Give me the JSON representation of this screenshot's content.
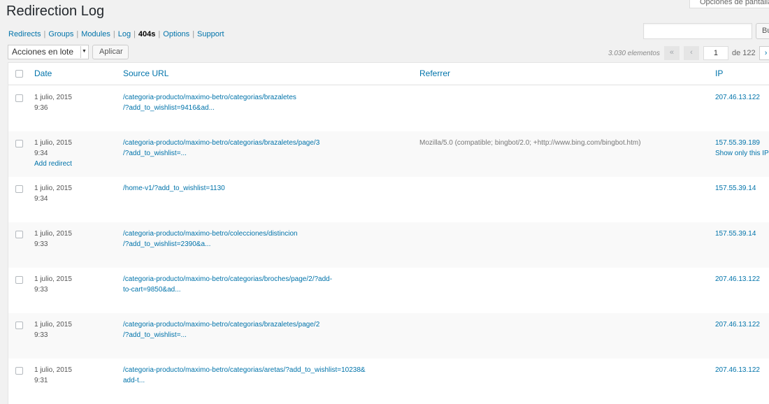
{
  "screen_options_label": "Opciones de pantalla",
  "page_title": "Redirection Log",
  "subnav": [
    {
      "label": "Redirects",
      "current": false
    },
    {
      "label": "Groups",
      "current": false
    },
    {
      "label": "Modules",
      "current": false
    },
    {
      "label": "Log",
      "current": false
    },
    {
      "label": "404s",
      "current": true
    },
    {
      "label": "Options",
      "current": false
    },
    {
      "label": "Support",
      "current": false
    }
  ],
  "search": {
    "value": "",
    "button_label": "Buscar"
  },
  "bulk": {
    "selected": "Acciones en lote",
    "apply_label": "Aplicar"
  },
  "pagination": {
    "count": "3.030 elementos",
    "first": "«",
    "prev": "‹",
    "current_page": "1",
    "of_label": "de 122",
    "next": "›"
  },
  "columns": {
    "date": "Date",
    "source": "Source URL",
    "referrer": "Referrer",
    "ip": "IP"
  },
  "rows": [
    {
      "date": "1 julio, 2015",
      "time": "9:36",
      "action": "",
      "source_1": "/categoria-producto/maximo-betro/categorias/brazaletes",
      "source_2": "/?add_to_wishlist=9416&ad...",
      "referrer": "",
      "ip": "207.46.13.122",
      "ip_action": ""
    },
    {
      "date": "1 julio, 2015",
      "time": "9:34",
      "action": "Add redirect",
      "source_1": "/categoria-producto/maximo-betro/categorias/brazaletes/page/3",
      "source_2": "/?add_to_wishlist=...",
      "referrer": "Mozilla/5.0 (compatible; bingbot/2.0; +http://www.bing.com/bingbot.htm)",
      "ip": "157.55.39.189",
      "ip_action": "Show only this IP"
    },
    {
      "date": "1 julio, 2015",
      "time": "9:34",
      "action": "",
      "source_1": "/home-v1/?add_to_wishlist=1130",
      "source_2": "",
      "referrer": "",
      "ip": "157.55.39.14",
      "ip_action": ""
    },
    {
      "date": "1 julio, 2015",
      "time": "9:33",
      "action": "",
      "source_1": "/categoria-producto/maximo-betro/colecciones/distincion",
      "source_2": "/?add_to_wishlist=2390&a...",
      "referrer": "",
      "ip": "157.55.39.14",
      "ip_action": ""
    },
    {
      "date": "1 julio, 2015",
      "time": "9:33",
      "action": "",
      "source_1": "/categoria-producto/maximo-betro/categorias/broches/page/2/?add-",
      "source_2": "to-cart=9850&ad...",
      "referrer": "",
      "ip": "207.46.13.122",
      "ip_action": ""
    },
    {
      "date": "1 julio, 2015",
      "time": "9:33",
      "action": "",
      "source_1": "/categoria-producto/maximo-betro/categorias/brazaletes/page/2",
      "source_2": "/?add_to_wishlist=...",
      "referrer": "",
      "ip": "207.46.13.122",
      "ip_action": ""
    },
    {
      "date": "1 julio, 2015",
      "time": "9:31",
      "action": "",
      "source_1": "/categoria-producto/maximo-betro/categorias/aretas/?add_to_wishlist=10238&",
      "source_2": "add-t...",
      "referrer": "",
      "ip": "207.46.13.122",
      "ip_action": ""
    }
  ]
}
